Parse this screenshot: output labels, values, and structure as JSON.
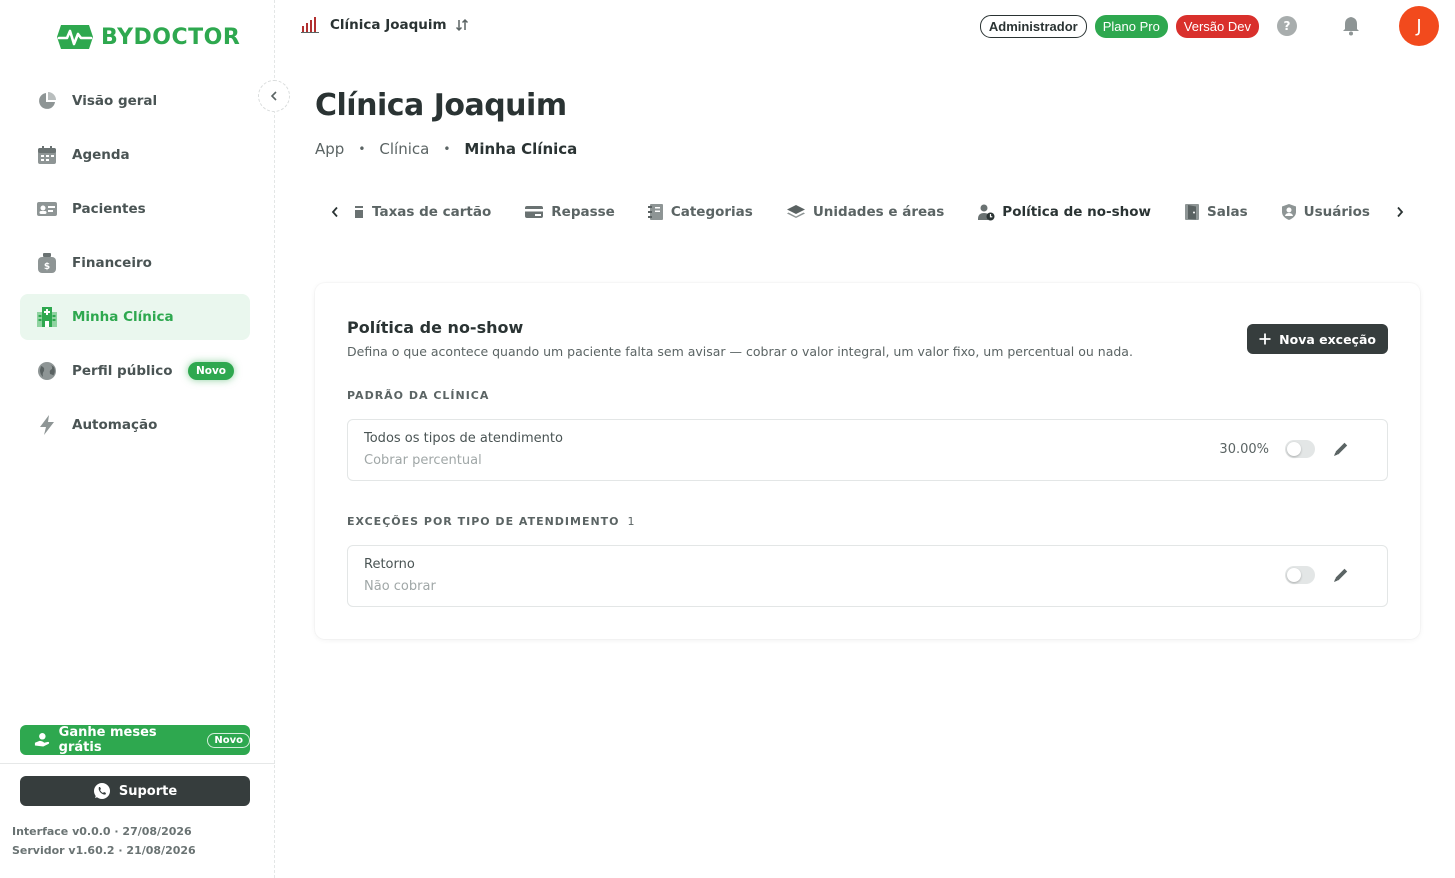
{
  "brand": {
    "name": "BYDOCTOR",
    "color": "#2ea84f"
  },
  "sidebar": {
    "items": [
      {
        "label": "Visão geral",
        "icon": "pie-chart-icon"
      },
      {
        "label": "Agenda",
        "icon": "calendar-icon"
      },
      {
        "label": "Pacientes",
        "icon": "id-card-icon"
      },
      {
        "label": "Financeiro",
        "icon": "money-bag-icon"
      },
      {
        "label": "Minha Clínica",
        "icon": "hospital-icon",
        "active": true
      },
      {
        "label": "Perfil público",
        "icon": "globe-icon",
        "badge": "Novo"
      },
      {
        "label": "Automação",
        "icon": "lightning-icon"
      }
    ],
    "promo": {
      "label": "Ganhe meses grátis",
      "badge": "Novo"
    },
    "support_label": "Suporte",
    "version_interface": "Interface v0.0.0 · 27/08/2026",
    "version_server": "Servidor v1.60.2 · 21/08/2026"
  },
  "header": {
    "clinic_name": "Clínica Joaquim",
    "tags": {
      "role": "Administrador",
      "plan": "Plano Pro",
      "env": "Versão Dev"
    },
    "help": "?",
    "avatar_initial": "J"
  },
  "page": {
    "title": "Clínica Joaquim",
    "breadcrumb": [
      "App",
      "Clínica",
      "Minha Clínica"
    ]
  },
  "tabs": [
    {
      "label": "Taxas de cartão",
      "icon": "card-icon"
    },
    {
      "label": "Repasse",
      "icon": "transfer-icon"
    },
    {
      "label": "Categorias",
      "icon": "notebook-icon"
    },
    {
      "label": "Unidades e áreas",
      "icon": "layers-icon"
    },
    {
      "label": "Política de no-show",
      "icon": "user-clock-icon",
      "active": true
    },
    {
      "label": "Salas",
      "icon": "door-icon"
    },
    {
      "label": "Usuários",
      "icon": "user-shield-icon"
    }
  ],
  "policy": {
    "title": "Política de no-show",
    "description": "Defina o que acontece quando um paciente falta sem avisar — cobrar o valor integral, um valor fixo, um percentual ou nada.",
    "new_button": "Nova exceção",
    "default_section": "PADRÃO DA CLÍNICA",
    "default_rule": {
      "name": "Todos os tipos de atendimento",
      "action": "Cobrar percentual",
      "value": "30.00%",
      "enabled": false
    },
    "exceptions_section": "EXCEÇÕES POR TIPO DE ATENDIMENTO",
    "exceptions_count": "1",
    "exceptions": [
      {
        "name": "Retorno",
        "action": "Não cobrar",
        "enabled": false
      }
    ]
  }
}
